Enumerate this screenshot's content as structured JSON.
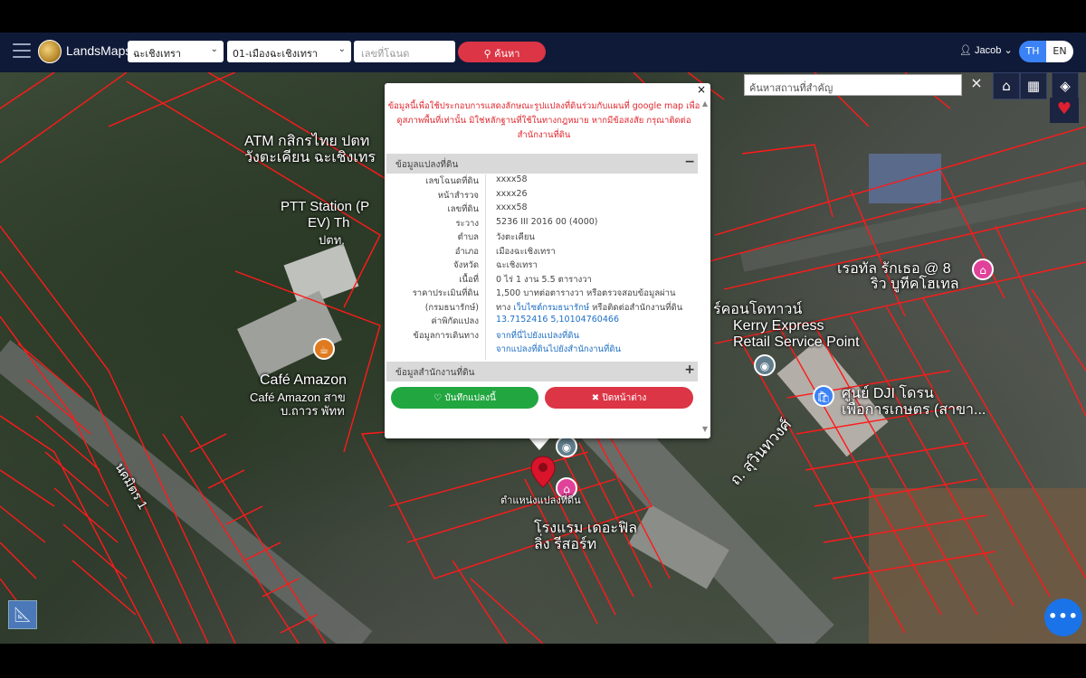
{
  "app": {
    "brand": "LandsMaps"
  },
  "navbar": {
    "province_select": "ฉะเชิงเทรา",
    "district_select": "01-เมืองฉะเชิงเทรา",
    "deed_placeholder": "เลขที่โฉนด",
    "search_label": "ค้นหา",
    "user_name": "Jacob",
    "lang_th": "TH",
    "lang_en": "EN"
  },
  "map_tools": {
    "poi_placeholder": "ค้นหาสถานที่สำคัญ",
    "close_symbol": "×"
  },
  "map_labels": {
    "atm": "ATM กสิกรไทย ปตท",
    "atm_sub": "วังตะเคียน ฉะเชิงเทร",
    "ptt": "PTT Station (P",
    "ptt2": "EV) Th",
    "ptt3": "ปตท.",
    "cafe": "Café Amazon",
    "cafe_sub": "Café Amazon สาข",
    "cafe_sub2": "บ.ถาวร พัทท",
    "kerry_top": "ร์คอนโดทาวน์",
    "kerry": "Kerry Express",
    "kerry2": "Retail Service Point",
    "dji": "ศูนย์ DJI โดรน",
    "dji2": "เพื่อการเกษตร (สาขา...",
    "resort": "เรอทัล รักเธอ @ 8",
    "resort2": "ริว บูทีคโฮเทล",
    "road_sukhumvit": "ถ. สุวินทวงศ์",
    "road_soi": "นคมิตร 1",
    "hotel": "โรงแรม เดอะฟิล",
    "hotel2": "ลิ่ง รีสอร์ท",
    "pin_label": "ตำแหน่งแปลงที่ดิน"
  },
  "popup": {
    "notice": "ข้อมูลนี้เพื่อใช้ประกอบการแสดงลักษณะรูปแปลงที่ดินร่วมกับแผนที่ google map เพื่อดูสภาพพื้นที่เท่านั้น มิใช่หลักฐานที่ใช้ในทางกฎหมาย หากมีข้อสงสัย กรุณาติดต่อสำนักงานที่ดิน",
    "section_parcel": "ข้อมูลแปลงที่ดิน",
    "section_office": "ข้อมูลสำนักงานที่ดิน",
    "rows": [
      {
        "k": "เลขโฉนดที่ดิน",
        "v": "xxxx58"
      },
      {
        "k": "หน้าสำรวจ",
        "v": "xxxx26"
      },
      {
        "k": "เลขที่ดิน",
        "v": "xxxx58"
      },
      {
        "k": "ระวาง",
        "v": "5236 III 2016 00 (4000)"
      },
      {
        "k": "ตำบล",
        "v": "วังตะเคียน"
      },
      {
        "k": "อำเภอ",
        "v": "เมืองฉะเชิงเทรา"
      },
      {
        "k": "จังหวัด",
        "v": "ฉะเชิงเทรา"
      },
      {
        "k": "เนื้อที่",
        "v": "0 ไร่ 1 งาน 5.5 ตารางวา"
      },
      {
        "k": "ราคาประเมินที่ดิน",
        "v": "1,500 บาทต่อตารางวา หรือตรวจสอบข้อมูลผ่าน"
      },
      {
        "k": "(กรมธนารักษ์)",
        "v_pre": "ทาง ",
        "v_link": "เว็บไซต์กรมธนารักษ์",
        "v_post": " หรือติดต่อสำนักงานที่ดิน"
      },
      {
        "k": "ค่าพิกัดแปลง",
        "v": "13.7152416 5,10104760466"
      },
      {
        "k": "ข้อมูลการเดินทาง",
        "v": "จากที่นี่ไปยังแปลงที่ดิน"
      },
      {
        "k": "",
        "v": "จากแปลงที่ดินไปยังสำนักงานที่ดิน"
      }
    ],
    "coord": "13.7152416 5,10104760466",
    "save_label": "บันทึกแปลงนี้",
    "close_label": "ปิดหน้าต่าง",
    "close_x": "×"
  },
  "colors": {
    "navbar": "#0f1a38",
    "accent_red": "#dc3545",
    "accent_green": "#22a63f",
    "parcel_line": "#ff1a1a"
  },
  "icons": [
    "hamburger-icon",
    "user-icon",
    "home-icon",
    "grid-icon",
    "layers-icon",
    "heart-icon",
    "search-icon",
    "ruler-icon",
    "more-icon"
  ]
}
